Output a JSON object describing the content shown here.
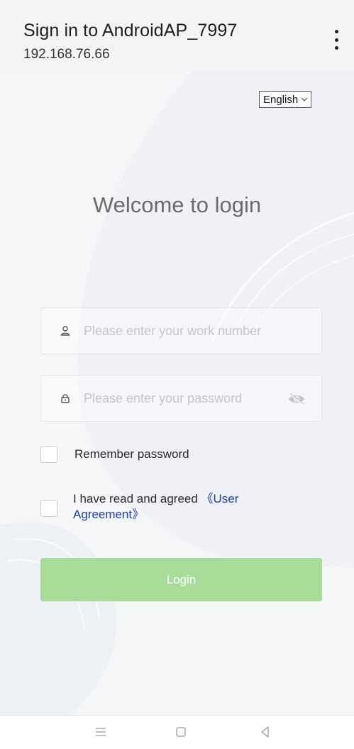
{
  "header": {
    "title": "Sign in to AndroidAP_7997",
    "subtitle": "192.168.76.66",
    "menu_icon": "kebab-menu-icon"
  },
  "language": {
    "selected": "English",
    "icon": "chevron-down-icon"
  },
  "welcome": "Welcome to login",
  "form": {
    "username_placeholder": "Please enter your work number",
    "username_value": "",
    "username_icon": "user-icon",
    "password_placeholder": "Please enter your password",
    "password_value": "",
    "password_icon": "lock-icon",
    "visibility_icon": "eye-hidden-icon",
    "remember_label": "Remember password",
    "remember_checked": false,
    "agree_prefix": "I have read and agreed ",
    "agree_link": "《User Agreement》",
    "agree_checked": false,
    "login_label": "Login"
  },
  "colors": {
    "login_button": "#a8dd99",
    "link": "#1a3fbf"
  },
  "system_nav": {
    "icons": [
      "menu-icon",
      "home-icon",
      "back-icon"
    ]
  }
}
